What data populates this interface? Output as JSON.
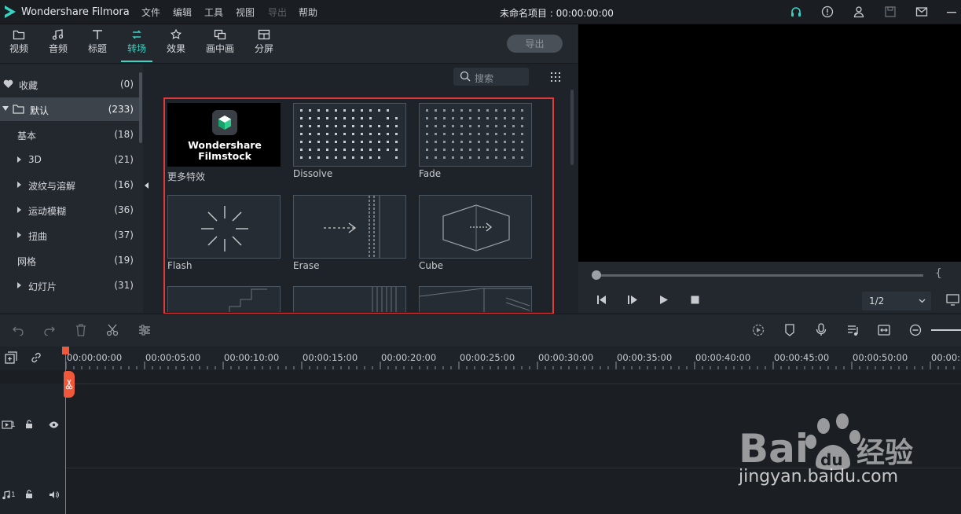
{
  "app": {
    "name": "Wondershare Filmora",
    "project_title": "未命名项目 : 00:00:00:00"
  },
  "menu": [
    "文件",
    "编辑",
    "工具",
    "视图",
    "导出",
    "帮助"
  ],
  "media_tabs": [
    {
      "label": "视频",
      "icon": "folder-icon"
    },
    {
      "label": "音频",
      "icon": "music-note-icon"
    },
    {
      "label": "标题",
      "icon": "title-t-icon"
    },
    {
      "label": "转场",
      "icon": "transition-icon",
      "active": true
    },
    {
      "label": "效果",
      "icon": "effects-icon"
    },
    {
      "label": "画中画",
      "icon": "pip-icon"
    },
    {
      "label": "分屏",
      "icon": "split-screen-icon"
    }
  ],
  "export_label": "导出",
  "sidebar": {
    "items": [
      {
        "label": "收藏",
        "count": "(0)"
      },
      {
        "label": "默认",
        "count": "(233)"
      },
      {
        "label": "基本",
        "count": "(18)"
      },
      {
        "label": "3D",
        "count": "(21)"
      },
      {
        "label": "波纹与溶解",
        "count": "(16)"
      },
      {
        "label": "运动模糊",
        "count": "(36)"
      },
      {
        "label": "扭曲",
        "count": "(37)"
      },
      {
        "label": "网格",
        "count": "(19)"
      },
      {
        "label": "幻灯片",
        "count": "(31)"
      }
    ]
  },
  "search": {
    "placeholder": "搜索"
  },
  "transitions": [
    {
      "label": "更多特效",
      "banner_line1": "Wondershare",
      "banner_line2": "Filmstock"
    },
    {
      "label": "Dissolve"
    },
    {
      "label": "Fade"
    },
    {
      "label": "Flash"
    },
    {
      "label": "Erase"
    },
    {
      "label": "Cube"
    }
  ],
  "preview": {
    "ratio": "1/2"
  },
  "timeline": {
    "timecodes": [
      "00:00:00:00",
      "00:00:05:00",
      "00:00:10:00",
      "00:00:15:00",
      "00:00:20:00",
      "00:00:25:00",
      "00:00:30:00",
      "00:00:35:00",
      "00:00:40:00",
      "00:00:45:00",
      "00:00:50:00",
      "00:00:5"
    ],
    "video_track": "1",
    "audio_track": "1"
  },
  "watermark": {
    "brand": "Bai du 经验",
    "url": "jingyan.baidu.com"
  },
  "colors": {
    "accent": "#39d3c3",
    "highlight_box": "#e23a3a",
    "playhead": "#f0583a"
  }
}
